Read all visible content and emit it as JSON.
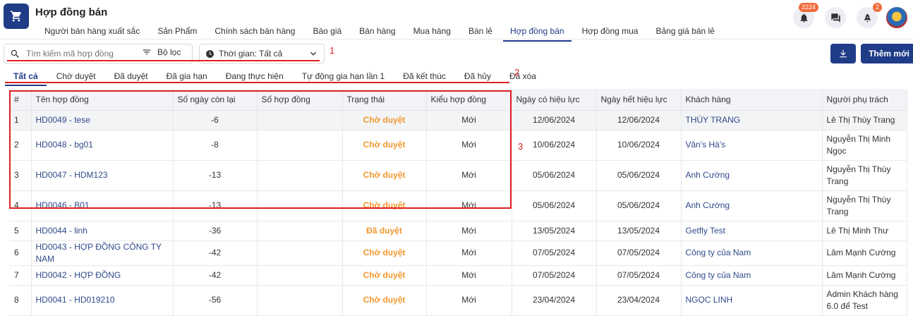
{
  "app": {
    "title": "Hợp đồng bán"
  },
  "nav": {
    "items": [
      "Người bán hàng xuất sắc",
      "Sản Phẩm",
      "Chính sách bán hàng",
      "Báo giá",
      "Bán hàng",
      "Mua hàng",
      "Bán lẻ",
      "Hợp đồng bán",
      "Hợp đồng mua",
      "Bảng giá bán lẻ"
    ],
    "active_index": 7
  },
  "notifications": {
    "bell_count": "2224",
    "rocket_count": "2"
  },
  "toolbar": {
    "search_placeholder": "Tìm kiếm mã hợp đồng",
    "filter_label": "Bộ lọc",
    "time_label": "Thời gian: Tất cả",
    "add_label": "Thêm mới"
  },
  "annotations": {
    "a1": "1",
    "a2": "2",
    "a3": "3"
  },
  "status_tabs": {
    "items": [
      "Tất cả",
      "Chờ duyệt",
      "Đã duyệt",
      "Đã gia hạn",
      "Đang thực hiện",
      "Tự động gia hạn lần 1",
      "Đã kết thúc",
      "Đã hủy",
      "Đã xóa"
    ],
    "active_index": 0
  },
  "table": {
    "headers": [
      "#",
      "Tên hợp đồng",
      "Số ngày còn lại",
      "Số hợp đồng",
      "Trạng thái",
      "Kiểu hợp đồng",
      "Ngày có hiệu lực",
      "Ngày hết hiệu lực",
      "Khách hàng",
      "Người phụ trách"
    ],
    "rows": [
      {
        "num": "1",
        "name": "HD0049 - tese",
        "days": "-6",
        "contract_no": "",
        "status": "Chờ duyệt",
        "type": "Mới",
        "start": "12/06/2024",
        "end": "12/06/2024",
        "customer": "THÙY TRANG",
        "owner": "Lê Thị Thùy Trang"
      },
      {
        "num": "2",
        "name": "HD0048 - bg01",
        "days": "-8",
        "contract_no": "",
        "status": "Chờ duyệt",
        "type": "Mới",
        "start": "10/06/2024",
        "end": "10/06/2024",
        "customer": "Văn's Hà's",
        "owner": "Nguyễn Thị Minh Ngọc"
      },
      {
        "num": "3",
        "name": "HD0047 - HDM123",
        "days": "-13",
        "contract_no": "",
        "status": "Chờ duyệt",
        "type": "Mới",
        "start": "05/06/2024",
        "end": "05/06/2024",
        "customer": "Anh Cường",
        "owner": "Nguyễn Thị Thùy Trang"
      },
      {
        "num": "4",
        "name": "HD0046 - B01",
        "days": "-13",
        "contract_no": "",
        "status": "Chờ duyệt",
        "type": "Mới",
        "start": "05/06/2024",
        "end": "05/06/2024",
        "customer": "Anh Cường",
        "owner": "Nguyễn Thị Thùy Trang"
      },
      {
        "num": "5",
        "name": "HD0044 - linh",
        "days": "-36",
        "contract_no": "",
        "status": "Đã duyệt",
        "type": "Mới",
        "start": "13/05/2024",
        "end": "13/05/2024",
        "customer": "Getfly Test",
        "owner": "Lê Thị Minh Thư"
      },
      {
        "num": "6",
        "name": "HD0043 - HỢP ĐỒNG CÔNG TY NAM",
        "days": "-42",
        "contract_no": "",
        "status": "Chờ duyệt",
        "type": "Mới",
        "start": "07/05/2024",
        "end": "07/05/2024",
        "customer": "Công ty của Nam",
        "owner": "Lâm Mạnh Cường"
      },
      {
        "num": "7",
        "name": "HD0042 - HỢP ĐỒNG",
        "days": "-42",
        "contract_no": "",
        "status": "Chờ duyệt",
        "type": "Mới",
        "start": "07/05/2024",
        "end": "07/05/2024",
        "customer": "Công ty của Nam",
        "owner": "Lâm Mạnh Cường"
      },
      {
        "num": "8",
        "name": "HD0041 - HD019210",
        "days": "-56",
        "contract_no": "",
        "status": "Chờ duyệt",
        "type": "Mới",
        "start": "23/04/2024",
        "end": "23/04/2024",
        "customer": "NGỌC LINH",
        "owner": "Admin Khách hàng 6.0 để Test"
      }
    ]
  },
  "colors": {
    "primary": "#1f3c88",
    "status_orange": "#f0982e",
    "annotation_red": "#e02020",
    "badge": "#f26b3a"
  }
}
